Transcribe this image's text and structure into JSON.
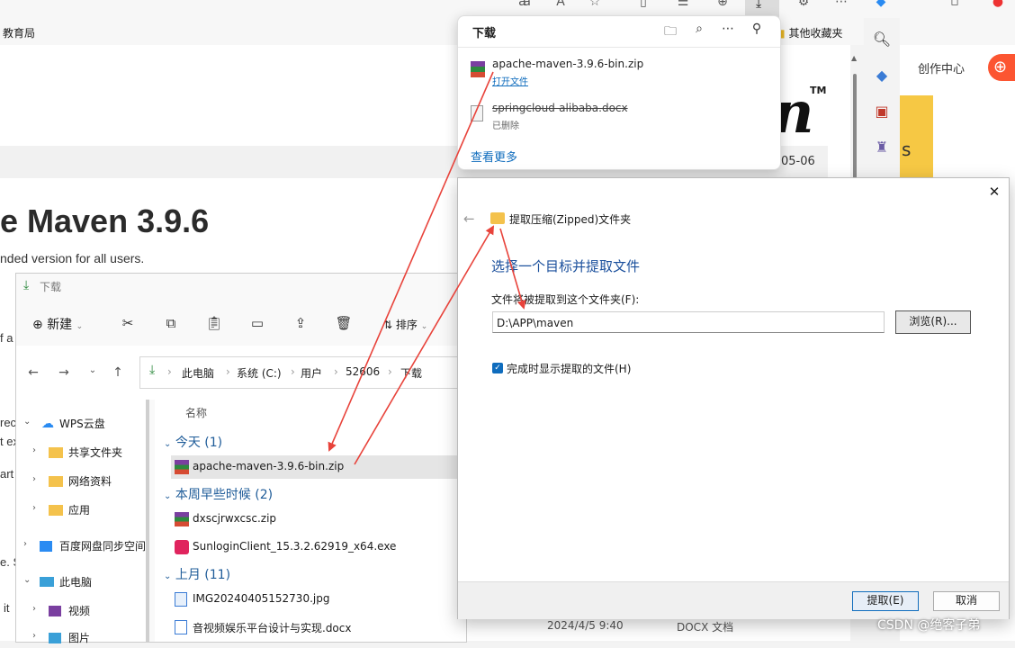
{
  "browser": {
    "favorites_bar_label": "教育局",
    "other_favorites": "其他收藏夹"
  },
  "webpage": {
    "heading": "e Maven 3.9.6",
    "subheading": "nded version for all users.",
    "date_fragment": "05-06",
    "logo_fragment": "n",
    "logo_tm": "TM",
    "edge_text": [
      "f a",
      "rec",
      "t ex",
      "art",
      "e. S",
      "it"
    ],
    "create_center": "创作中心",
    "ad_text": "s",
    "watermark": "CSDN @绝客子弟"
  },
  "downloads_panel": {
    "title": "下载",
    "items": [
      {
        "name": "apache-maven-3.9.6-bin.zip",
        "action": "打开文件"
      },
      {
        "name": "springcloud-alibaba.docx",
        "status": "已删除"
      }
    ],
    "see_more": "查看更多"
  },
  "explorer": {
    "title": "下载",
    "toolbar": {
      "new_label": "新建",
      "sort_label": "排序"
    },
    "breadcrumb": [
      "此电脑",
      "系统 (C:)",
      "用户",
      "52606",
      "下载"
    ],
    "nav": [
      {
        "label": "WPS云盘",
        "expanded": true
      },
      {
        "label": "共享文件夹"
      },
      {
        "label": "网络资料"
      },
      {
        "label": "应用"
      },
      {
        "label": "百度网盘同步空间"
      },
      {
        "label": "此电脑",
        "expanded": true
      },
      {
        "label": "视频"
      },
      {
        "label": "图片"
      }
    ],
    "column_name": "名称",
    "groups": [
      {
        "label": "今天 (1)",
        "files": [
          "apache-maven-3.9.6-bin.zip"
        ]
      },
      {
        "label": "本周早些时候 (2)",
        "files": [
          "dxscjrwxcsc.zip",
          "SunloginClient_15.3.2.62919_x64.exe"
        ]
      },
      {
        "label": "上月 (11)",
        "files": [
          "IMG20240405152730.jpg",
          "音视频娱乐平台设计与实现.docx"
        ]
      }
    ],
    "last_row_date": "2024/4/5 9:40",
    "last_row_type": "DOCX 文档"
  },
  "extract_dialog": {
    "title": "提取压缩(Zipped)文件夹",
    "heading": "选择一个目标并提取文件",
    "label": "文件将被提取到这个文件夹(F):",
    "path": "D:\\APP\\maven",
    "browse": "浏览(R)...",
    "checkbox_label": "完成时显示提取的文件(H)",
    "checkbox_checked": true,
    "ok": "提取(E)",
    "cancel": "取消"
  },
  "colors": {
    "accent": "#0f6cbd",
    "arrow": "#e8433b",
    "csdn_orange": "#fc5531"
  }
}
